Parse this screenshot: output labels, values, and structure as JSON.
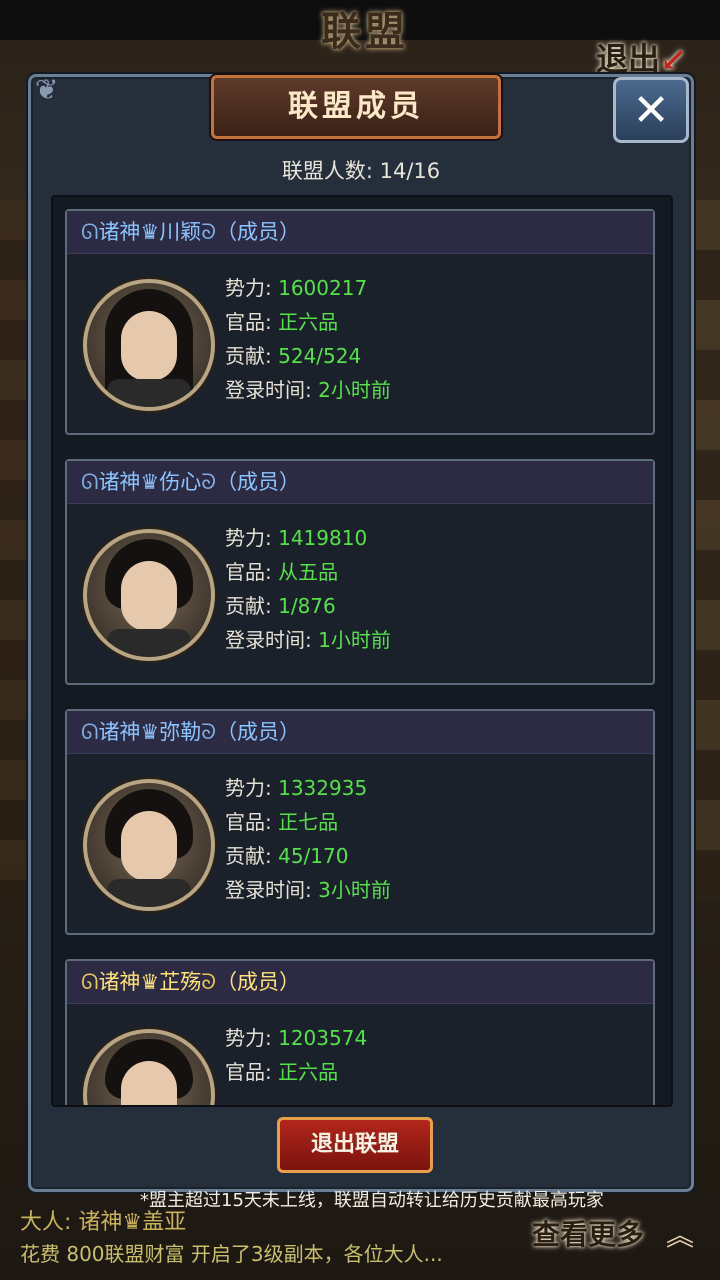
{
  "background": {
    "title": "联盟",
    "exit_label": "退出"
  },
  "panel": {
    "title": "联盟成员",
    "member_count_label": "联盟人数:",
    "member_count_value": "14/16",
    "close_icon": "close-x-icon"
  },
  "members": [
    {
      "prefix": "诸神♛",
      "name": "川颖",
      "role": "（成员）",
      "color": "blue",
      "power_label": "势力:",
      "power": "1600217",
      "rank_label": "官品:",
      "rank": "正六品",
      "contribution_label": "贡献:",
      "contribution": "524/524",
      "login_label": "登录时间:",
      "login": "2小时前"
    },
    {
      "prefix": "诸神♛",
      "name": "伤心",
      "role": "（成员）",
      "color": "blue",
      "power_label": "势力:",
      "power": "1419810",
      "rank_label": "官品:",
      "rank": "从五品",
      "contribution_label": "贡献:",
      "contribution": "1/876",
      "login_label": "登录时间:",
      "login": "1小时前"
    },
    {
      "prefix": "诸神♛",
      "name": "弥勒",
      "role": "（成员）",
      "color": "blue",
      "power_label": "势力:",
      "power": "1332935",
      "rank_label": "官品:",
      "rank": "正七品",
      "contribution_label": "贡献:",
      "contribution": "45/170",
      "login_label": "登录时间:",
      "login": "3小时前"
    },
    {
      "prefix": "诸神♛",
      "name": "芷殇",
      "role": "（成员）",
      "color": "gold",
      "power_label": "势力:",
      "power": "1203574",
      "rank_label": "官品:",
      "rank": "正六品"
    }
  ],
  "exit_button": "退出联盟",
  "notice": "*盟主超过15天未上线，联盟自动转让给历史贡献最高玩家",
  "chat": {
    "line1_who": "大人:",
    "line1_name": "诸神♛盖亚",
    "line2": "花费 800联盟财富 开启了3级副本，各位大人..."
  },
  "more_button": "查看更多",
  "colors": {
    "panel_bg": "#252f3b",
    "value_green": "#55e14a",
    "name_blue": "#8cc4ff",
    "name_gold": "#ffe27a",
    "button_red": "#b3261c"
  }
}
